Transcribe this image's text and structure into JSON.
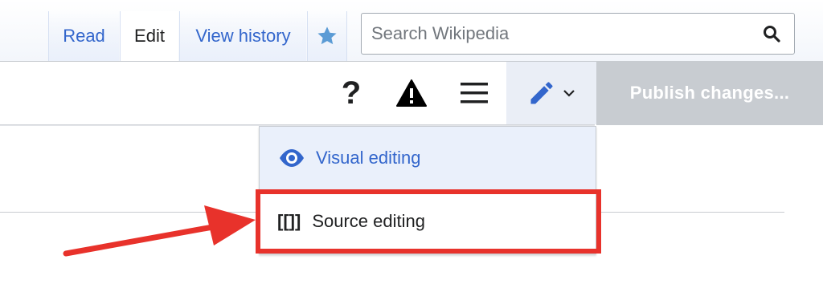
{
  "tabs": {
    "read": "Read",
    "edit": "Edit",
    "view_history": "View history",
    "watch_icon": "star-icon"
  },
  "search": {
    "placeholder": "Search Wikipedia",
    "icon": "search-icon"
  },
  "toolbar": {
    "help_label": "?",
    "notices_icon": "warning-icon",
    "menu_icon": "hamburger-icon",
    "editor_switch_icon": "pencil-icon",
    "publish_label": "Publish changes..."
  },
  "editor_menu": {
    "items": [
      {
        "label": "Visual editing",
        "icon": "eye-icon",
        "selected": true
      },
      {
        "label": "Source editing",
        "icon_text": "[[]]",
        "selected": false
      }
    ]
  },
  "annotation": {
    "color": "#e8322b",
    "target": "Source editing"
  },
  "colors": {
    "link": "#3366cc",
    "text": "#202122",
    "publish_disabled": "#c8ccd1",
    "highlight": "#e8322b"
  }
}
